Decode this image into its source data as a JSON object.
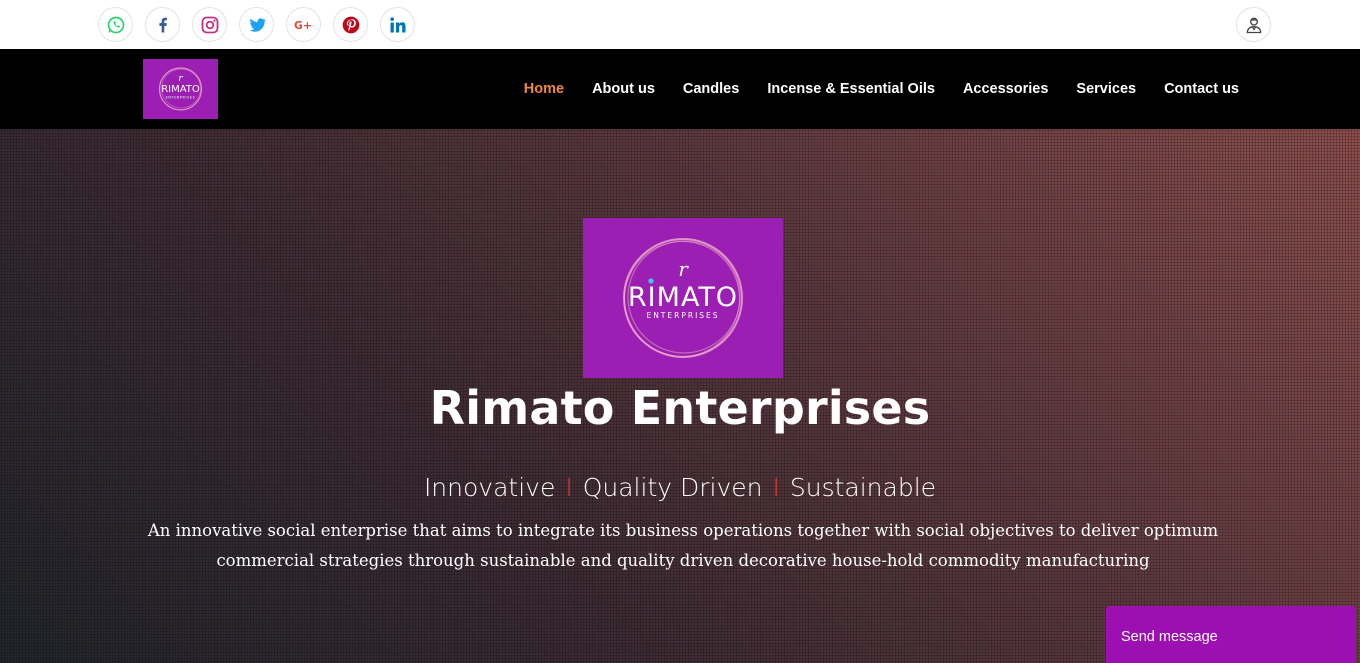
{
  "social_links": [
    {
      "name": "whatsapp",
      "icon": "whatsapp-icon",
      "color": "#25d366"
    },
    {
      "name": "facebook",
      "icon": "facebook-icon",
      "color": "#3b5998"
    },
    {
      "name": "instagram",
      "icon": "instagram-icon",
      "color": "#c13584"
    },
    {
      "name": "twitter",
      "icon": "twitter-icon",
      "color": "#1da1f2"
    },
    {
      "name": "google-plus",
      "icon": "google-plus-icon",
      "color": "#dd4b39"
    },
    {
      "name": "pinterest",
      "icon": "pinterest-icon",
      "color": "#bd081c"
    },
    {
      "name": "linkedin",
      "icon": "linkedin-icon",
      "color": "#0077b5"
    }
  ],
  "user_button": {
    "icon": "user-icon"
  },
  "brand": {
    "logo_letter": "r",
    "logo_name": "RIMATO",
    "logo_sub": "ENTERPRISES",
    "logo_bg": "#9b1fb3"
  },
  "nav": {
    "items": [
      {
        "label": "Home",
        "active": true
      },
      {
        "label": "About us"
      },
      {
        "label": "Candles"
      },
      {
        "label": "Incense & Essential Oils"
      },
      {
        "label": "Accessories"
      },
      {
        "label": "Services"
      },
      {
        "label": "Contact us"
      }
    ],
    "active_color": "#f0893a"
  },
  "hero": {
    "title": "Rimato Enterprises",
    "tagline": [
      "Innovative",
      "Quality Driven",
      "Sustainable"
    ],
    "separator": "I",
    "description": "An innovative social enterprise that aims to integrate its business operations together with social objectives to deliver optimum commercial strategies through sustainable and quality driven decorative house-hold commodity manufacturing"
  },
  "chat": {
    "label": "Send message",
    "color": "#9c0fb0"
  }
}
